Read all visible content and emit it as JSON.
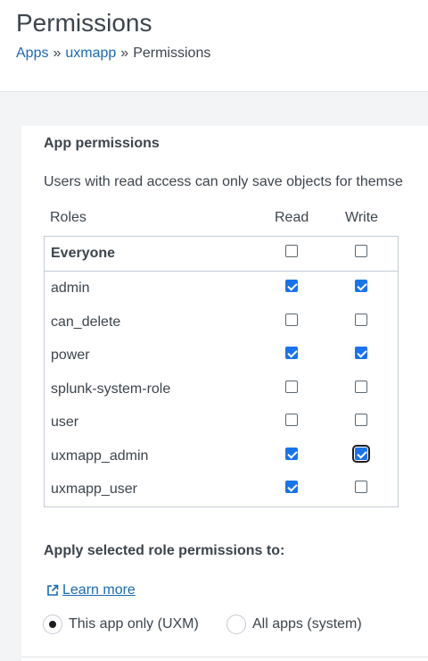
{
  "header": {
    "title": "Permissions",
    "breadcrumb": [
      {
        "label": "Apps",
        "link": true
      },
      {
        "label": "uxmapp",
        "link": true
      },
      {
        "label": "Permissions",
        "link": false
      }
    ],
    "separator": "»"
  },
  "app_permissions": {
    "title": "App permissions",
    "description": "Users with read access can only save objects for themse",
    "columns": {
      "roles": "Roles",
      "read": "Read",
      "write": "Write"
    },
    "rows": [
      {
        "role": "Everyone",
        "read": false,
        "write": false,
        "bold": true
      },
      {
        "role": "admin",
        "read": true,
        "write": true
      },
      {
        "role": "can_delete",
        "read": false,
        "write": false
      },
      {
        "role": "power",
        "read": true,
        "write": true
      },
      {
        "role": "splunk-system-role",
        "read": false,
        "write": false
      },
      {
        "role": "user",
        "read": false,
        "write": false
      },
      {
        "role": "uxmapp_admin",
        "read": true,
        "write": true,
        "write_focused": true
      },
      {
        "role": "uxmapp_user",
        "read": true,
        "write": false
      }
    ]
  },
  "apply": {
    "title": "Apply selected role permissions to:",
    "learn_more": "Learn more",
    "options": [
      {
        "label": "This app only (UXM)",
        "selected": true
      },
      {
        "label": "All apps (system)",
        "selected": false
      }
    ]
  },
  "colors": {
    "link": "#1a69b0",
    "check": "#1a73e8",
    "text": "#3c444d",
    "border": "#c3cbd4"
  }
}
